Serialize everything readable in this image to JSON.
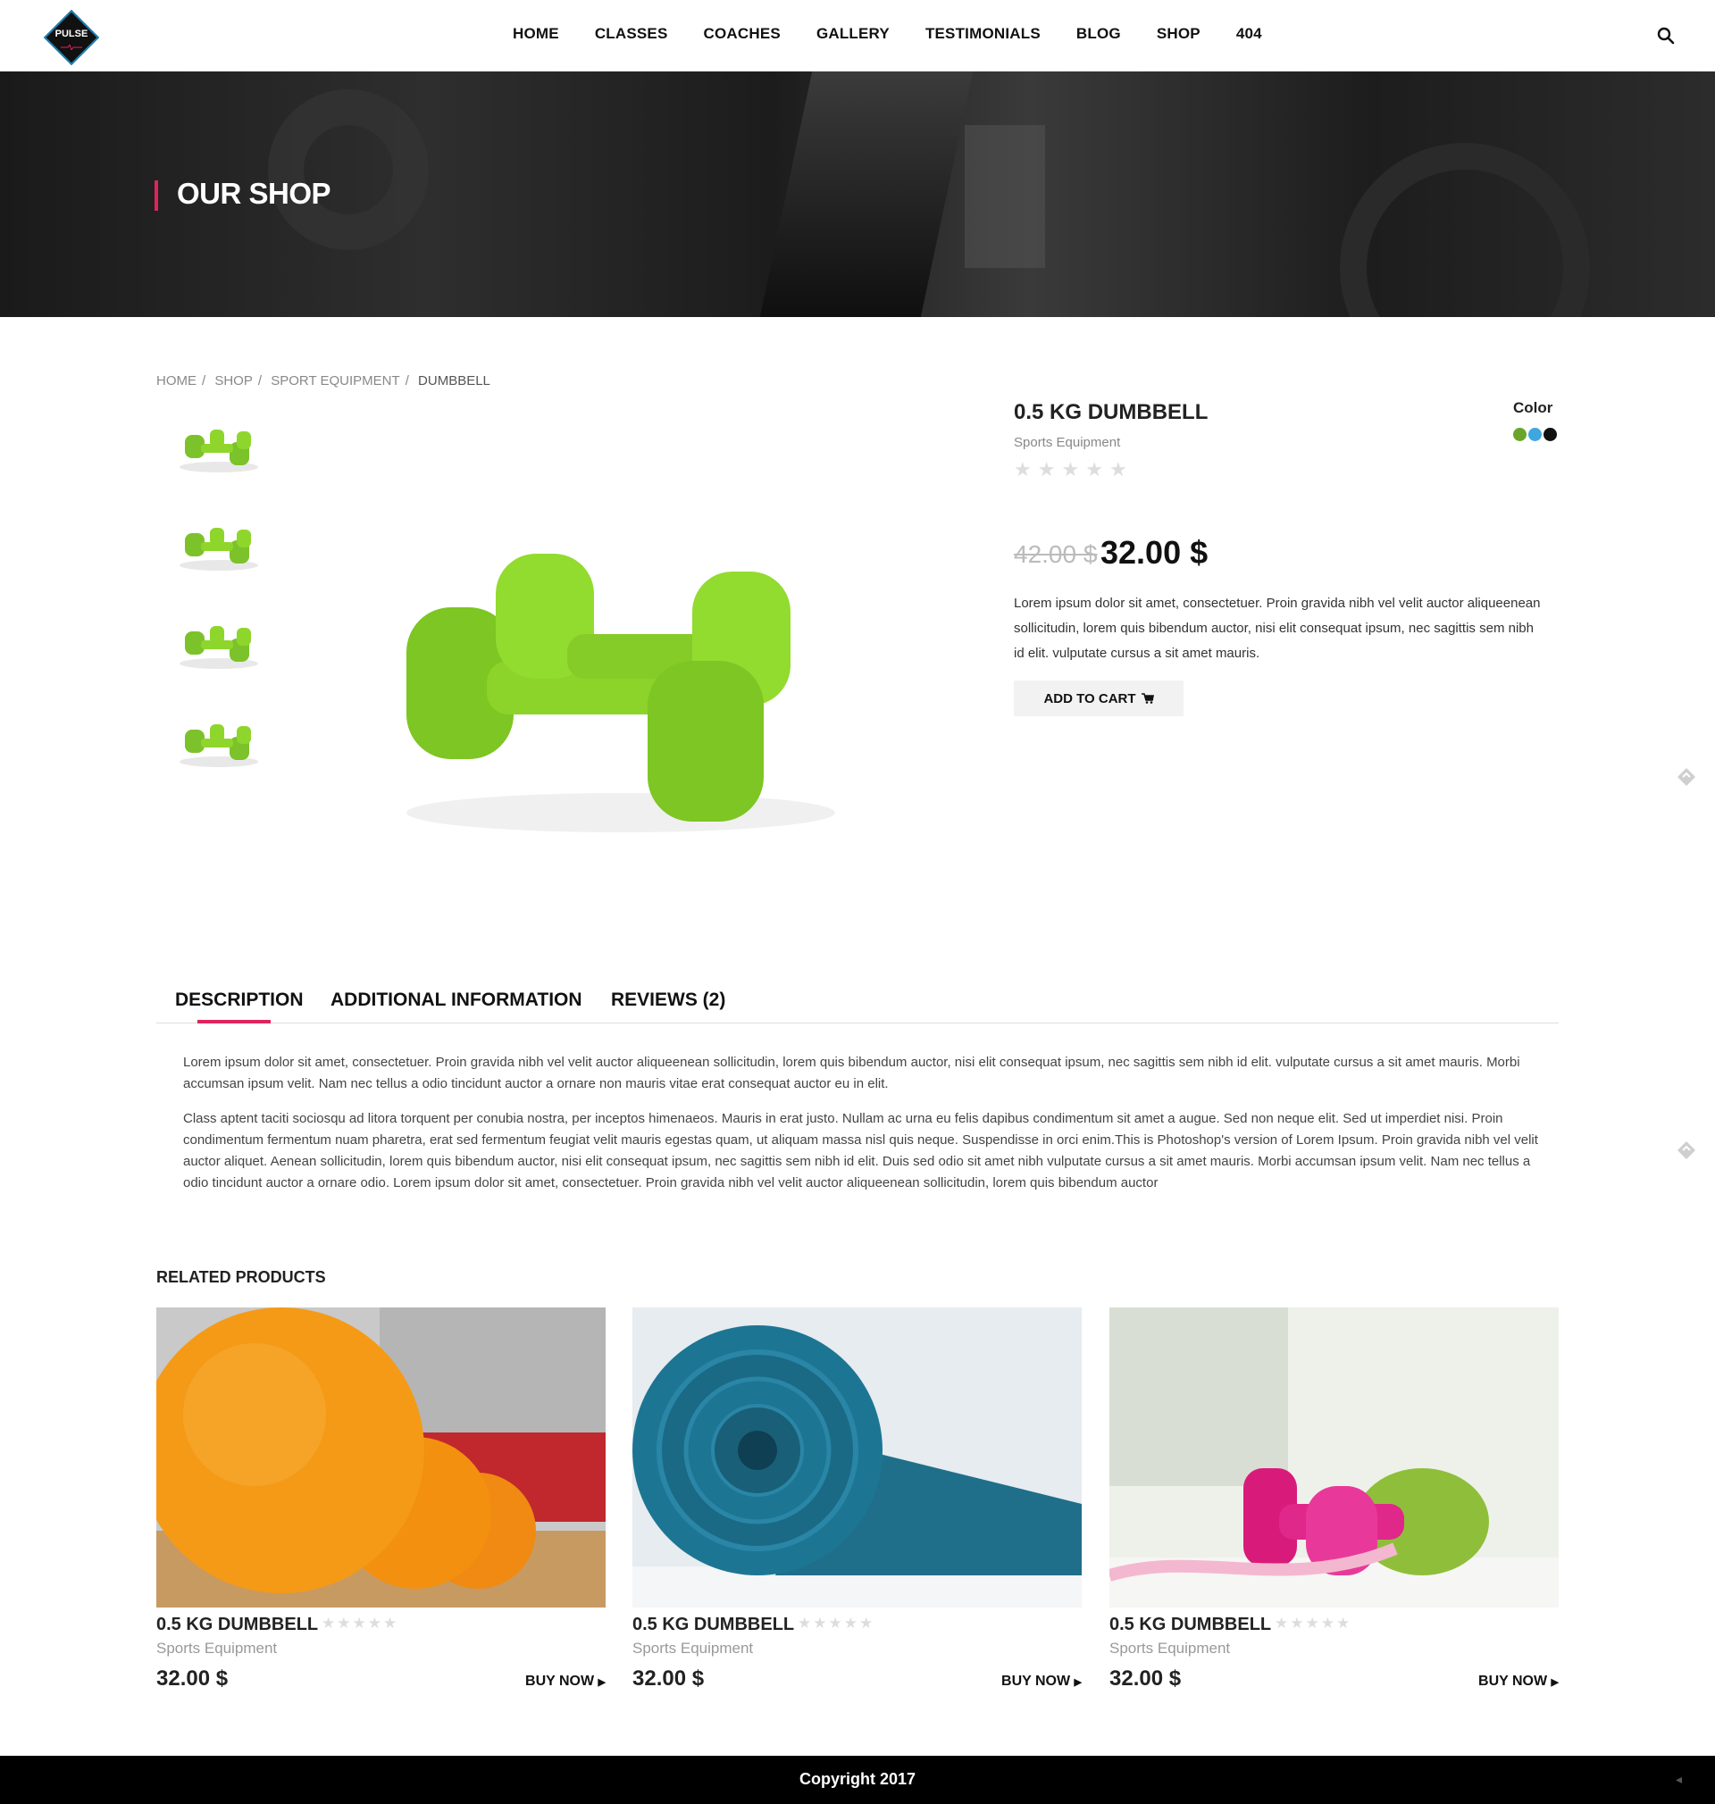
{
  "header": {
    "logo_text": "PULSE",
    "nav": [
      "HOME",
      "CLASSES",
      "COACHES",
      "GALLERY",
      "TESTIMONIALS",
      "BLOG",
      "SHOP",
      "404"
    ],
    "search_icon": "search-icon"
  },
  "hero": {
    "title": "OUR SHOP"
  },
  "breadcrumb": {
    "items": [
      "HOME",
      "SHOP",
      "SPORT EQUIPMENT",
      "DUMBBELL"
    ]
  },
  "product": {
    "title": "0.5 KG DUMBBELL",
    "category": "Sports Equipment",
    "rating": 0,
    "rating_max": 5,
    "color_label": "Color",
    "colors": [
      "#6aa52a",
      "#3ea7e0",
      "#111111"
    ],
    "old_price": "42.00 $",
    "price": "32.00 $",
    "description": "Lorem ipsum dolor sit amet, consectetuer. Proin gravida nibh vel velit auctor aliqueenean sollicitudin, lorem quis bibendum auctor, nisi elit consequat ipsum, nec sagittis sem nibh id elit. vulputate cursus a sit amet mauris.",
    "cart_label": "ADD TO CART",
    "cart_icon": "cart-icon",
    "image_color": "#8ed62c"
  },
  "tabs": {
    "items": [
      "DESCRIPTION",
      "ADDITIONAL INFORMATION",
      "REVIEWS (2)"
    ],
    "active": "DESCRIPTION",
    "accent": "#e0245e",
    "paragraphs": [
      "Lorem ipsum dolor sit amet, consectetuer. Proin gravida nibh vel velit auctor aliqueenean sollicitudin, lorem quis bibendum auctor, nisi elit consequat ipsum, nec sagittis sem nibh id elit. vulputate cursus a sit amet mauris. Morbi accumsan ipsum velit. Nam nec tellus a odio tincidunt auctor a ornare non mauris vitae erat consequat auctor eu in elit.",
      "Class aptent taciti sociosqu ad litora torquent per conubia nostra, per inceptos himenaeos. Mauris in erat justo. Nullam ac urna eu felis dapibus condimentum sit amet a augue. Sed non neque elit. Sed ut imperdiet nisi. Proin condimentum fermentum nuam pharetra, erat sed fermentum feugiat velit mauris egestas quam, ut aliquam massa nisl quis neque. Suspendisse in orci enim.This is Photoshop's version of Lorem Ipsum. Proin gravida nibh vel velit auctor aliquet. Aenean sollicitudin, lorem quis bibendum auctor, nisi elit consequat ipsum, nec sagittis sem nibh id elit. Duis sed odio sit amet nibh vulputate cursus a sit amet mauris. Morbi accumsan ipsum velit. Nam nec tellus a odio tincidunt auctor a ornare odio. Lorem ipsum dolor sit amet, consectetuer. Proin gravida nibh vel velit auctor aliqueenean sollicitudin, lorem quis bibendum auctor"
    ]
  },
  "related": {
    "heading": "RELATED PRODUCTS",
    "items": [
      {
        "title": "0.5 KG DUMBBELL",
        "category": "Sports Equipment",
        "price": "32.00 $",
        "buy": "BUY NOW"
      },
      {
        "title": "0.5 KG DUMBBELL",
        "category": "Sports Equipment",
        "price": "32.00 $",
        "buy": "BUY NOW"
      },
      {
        "title": "0.5 KG DUMBBELL",
        "category": "Sports Equipment",
        "price": "32.00 $",
        "buy": "BUY NOW"
      }
    ]
  },
  "footer": {
    "copyright": "Copyright 2017"
  }
}
